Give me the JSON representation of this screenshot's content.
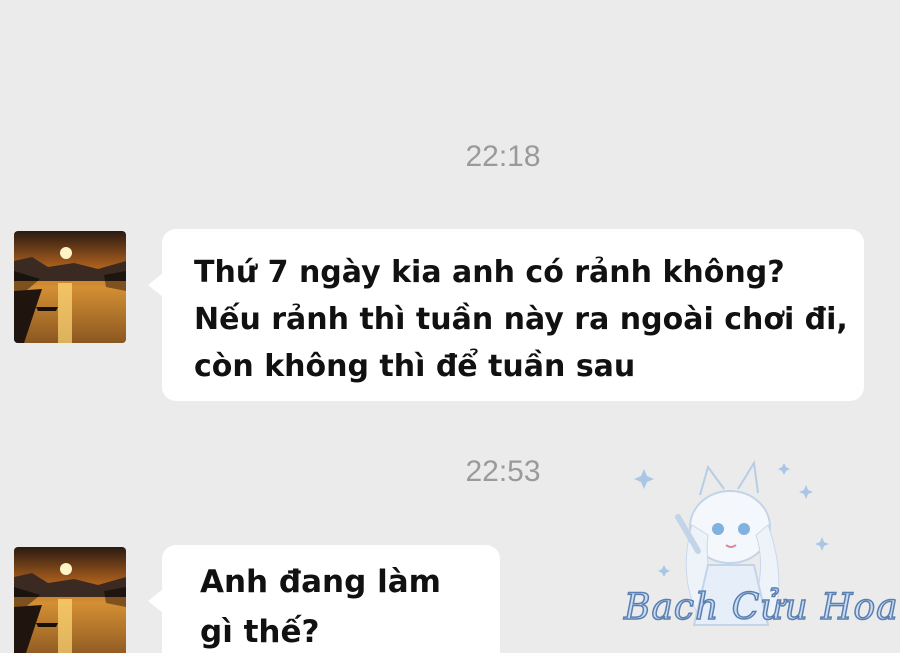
{
  "conversation": {
    "timestamps": [
      "22:18",
      "22:53"
    ],
    "messages": [
      {
        "text": "Thứ 7 ngày kia anh có rảnh không? Nếu rảnh thì tuần này ra ngoài chơi đi, còn không thì để tuần sau"
      },
      {
        "text": "Anh đang làm gì thế?"
      }
    ]
  },
  "watermark": {
    "text": "Bach Cửu Hoa"
  },
  "colors": {
    "background": "#ebebeb",
    "bubble": "#ffffff",
    "timestamp": "#9a9a9a",
    "watermark_fill": "#c9dcf2",
    "watermark_stroke": "#5b7fb0"
  }
}
